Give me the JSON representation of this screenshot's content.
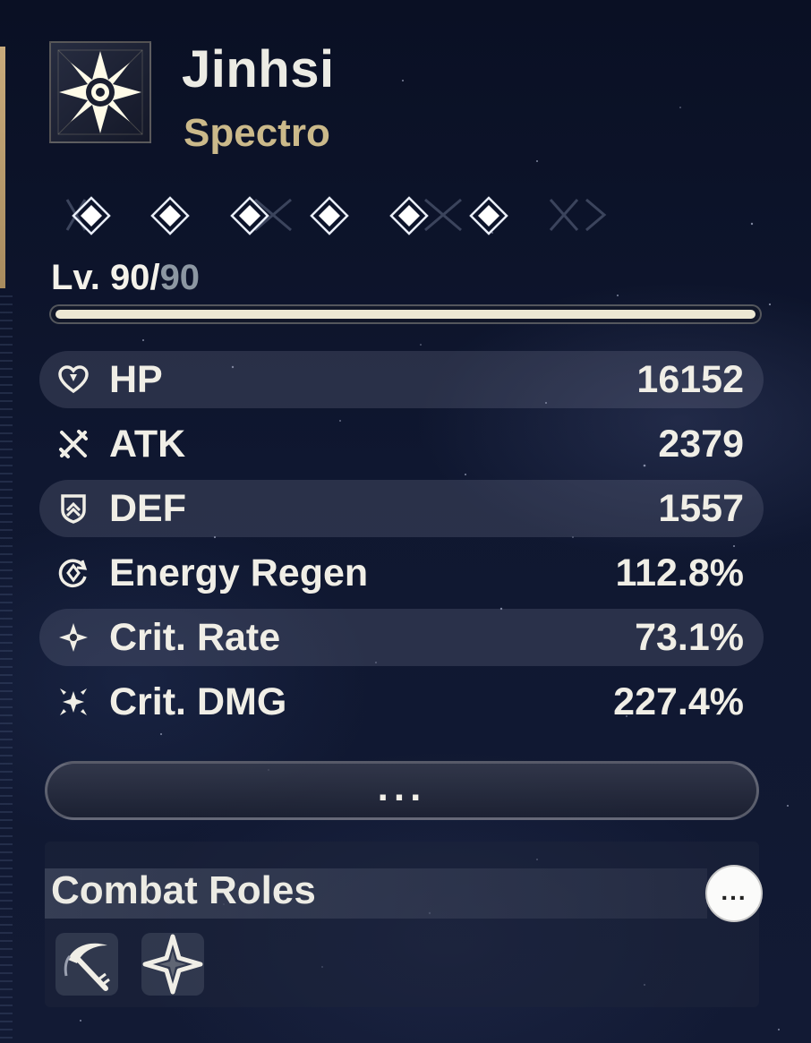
{
  "character": {
    "name": "Jinhsi",
    "element": "Spectro",
    "element_icon": "spectro-icon",
    "sequence_nodes_unlocked": 6,
    "sequence_nodes_total": 6
  },
  "level": {
    "label_prefix": "Lv. ",
    "current": "90",
    "separator": "/",
    "max": "90",
    "progress": 1.0
  },
  "stats": [
    {
      "icon": "heart-icon",
      "label": "HP",
      "value": "16152"
    },
    {
      "icon": "crossed-swords-icon",
      "label": "ATK",
      "value": "2379"
    },
    {
      "icon": "shield-icon",
      "label": "DEF",
      "value": "1557"
    },
    {
      "icon": "energy-regen-icon",
      "label": "Energy Regen",
      "value": "112.8%"
    },
    {
      "icon": "crit-rate-icon",
      "label": "Crit. Rate",
      "value": "73.1%"
    },
    {
      "icon": "crit-dmg-icon",
      "label": "Crit. DMG",
      "value": "227.4%"
    }
  ],
  "more_button": {
    "label": "..."
  },
  "combat_roles": {
    "title": "Combat Roles",
    "more_label": "...",
    "roles": [
      {
        "icon": "sickle-blade-icon"
      },
      {
        "icon": "four-point-star-icon"
      }
    ]
  },
  "colors": {
    "accent_gold": "#cbb98a",
    "text": "#ecebe4",
    "background": "#0c1226"
  }
}
